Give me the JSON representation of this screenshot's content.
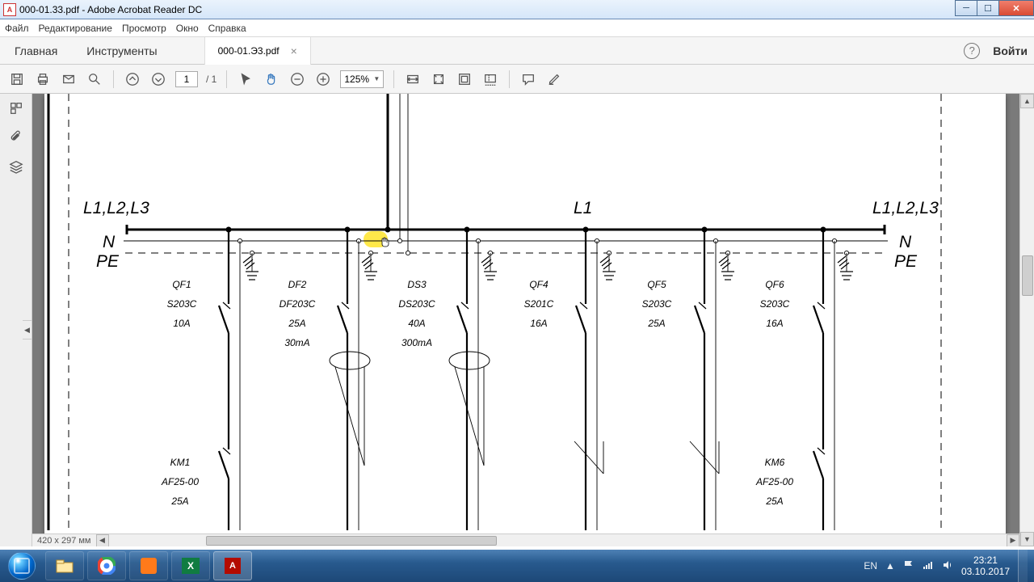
{
  "window": {
    "title": "000-01.33.pdf - Adobe Acrobat Reader DC"
  },
  "menu": {
    "file": "Файл",
    "edit": "Редактирование",
    "view": "Просмотр",
    "window": "Окно",
    "help": "Справка"
  },
  "tabs": {
    "home": "Главная",
    "tools": "Инструменты",
    "doc": "000-01.Э3.pdf",
    "login": "Войти"
  },
  "toolbar": {
    "page": "1",
    "page_total": "/ 1",
    "zoom": "125%"
  },
  "content": {
    "paper_dim": "420 x 297 мм"
  },
  "diagram": {
    "busbars": {
      "L_left": "L1,L2,L3",
      "L_mid": "L1",
      "L_right": "L1,L2,L3",
      "N": "N",
      "PE": "PE"
    },
    "breakers": [
      {
        "id": "QF1",
        "model": "S203C",
        "rating": "10A",
        "rcd": ""
      },
      {
        "id": "DF2",
        "model": "DF203C",
        "rating": "25A",
        "rcd": "30mA"
      },
      {
        "id": "DS3",
        "model": "DS203C",
        "rating": "40A",
        "rcd": "300mA"
      },
      {
        "id": "QF4",
        "model": "S201C",
        "rating": "16A",
        "rcd": ""
      },
      {
        "id": "QF5",
        "model": "S203C",
        "rating": "25A",
        "rcd": ""
      },
      {
        "id": "QF6",
        "model": "S203C",
        "rating": "16A",
        "rcd": ""
      }
    ],
    "contactors": [
      {
        "id": "KM1",
        "model": "AF25-00",
        "rating": "25A"
      },
      {
        "id": "KM6",
        "model": "AF25-00",
        "rating": "25A"
      }
    ]
  },
  "systray": {
    "lang": "EN",
    "time": "23:21",
    "date": "03.10.2017"
  }
}
